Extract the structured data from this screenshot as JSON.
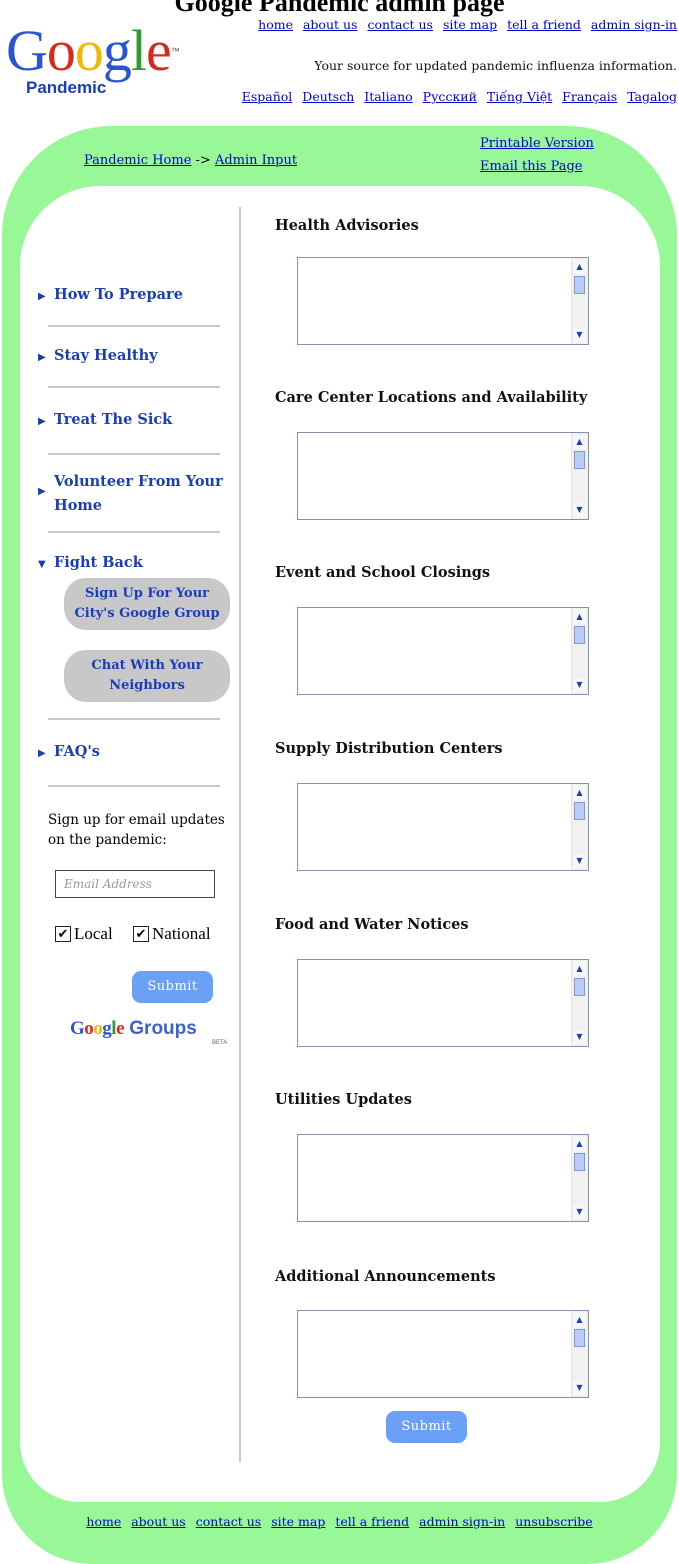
{
  "page": {
    "cut_title": "Google Pandemic admin page"
  },
  "header": {
    "logo_word": "Google",
    "logo_sub": "Pandemic",
    "top_nav": [
      "home",
      "about us",
      "contact us",
      "site map",
      "tell a friend",
      "admin sign-in"
    ],
    "tagline": "Your source for updated pandemic influenza information.",
    "languages": [
      "Español",
      "Deutsch",
      "Italiano",
      "Русский",
      "Tiếng Việt",
      "Français",
      "Tagalog"
    ]
  },
  "breadcrumb": {
    "home": "Pandemic Home",
    "separator": " -> ",
    "current": "Admin Input"
  },
  "utility_links": {
    "printable": "Printable Version",
    "email": "Email this Page"
  },
  "sidebar": {
    "items": [
      {
        "label": "How To Prepare",
        "icon": "triangle-right"
      },
      {
        "label": "Stay Healthy",
        "icon": "triangle-right"
      },
      {
        "label": "Treat The Sick",
        "icon": "triangle-right"
      },
      {
        "label": "Volunteer From Your Home",
        "icon": "triangle-right"
      },
      {
        "label": "Fight Back",
        "icon": "triangle-down"
      },
      {
        "label": "FAQ's",
        "icon": "triangle-right"
      }
    ],
    "fight_back_subitems": [
      "Sign Up For Your City's Google Group",
      "Chat With Your Neighbors"
    ],
    "signup_text": "Sign up for email updates on the pandemic:",
    "email_placeholder": "Email Address",
    "checkboxes": [
      {
        "label": "Local",
        "checked": true
      },
      {
        "label": "National",
        "checked": true
      }
    ],
    "submit_label": "Submit",
    "groups_logo": {
      "google": "Google",
      "groups": "Groups",
      "beta": "BETA"
    }
  },
  "main": {
    "sections": [
      {
        "title": "Health Advisories",
        "value": ""
      },
      {
        "title": "Care Center Locations and Availability",
        "value": ""
      },
      {
        "title": "Event and School Closings",
        "value": ""
      },
      {
        "title": "Supply Distribution Centers",
        "value": ""
      },
      {
        "title": "Food and Water Notices",
        "value": ""
      },
      {
        "title": "Utilities Updates",
        "value": ""
      },
      {
        "title": "Additional Announcements",
        "value": ""
      }
    ],
    "submit_label": "Submit"
  },
  "footer": {
    "links": [
      "home",
      "about us",
      "contact us",
      "site map",
      "tell a friend",
      "admin sign-in",
      "unsubscribe"
    ]
  },
  "colors": {
    "frame_green": "#98f898",
    "link_blue": "#0000cc",
    "nav_blue": "#1a3fb5",
    "button_blue": "#6aa0f5",
    "pill_gray": "#c8c8c8"
  }
}
